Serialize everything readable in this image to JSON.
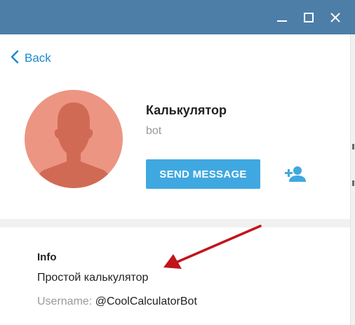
{
  "window": {
    "controls": [
      "minimize-icon",
      "maximize-icon",
      "close-icon"
    ],
    "titlebar_color": "#4d7ea8"
  },
  "nav": {
    "back_label": "Back",
    "back_icon": "chevron-left-icon"
  },
  "profile": {
    "name": "Калькулятор",
    "subtitle": "bot",
    "avatar_icon": "user-silhouette-icon",
    "avatar_color": "#ec9583",
    "send_button_label": "SEND MESSAGE",
    "add_contact_icon": "add-user-icon"
  },
  "info": {
    "title": "Info",
    "description": "Простой калькулятор",
    "username_label": "Username:",
    "username_value": "@CoolCalculatorBot"
  },
  "colors": {
    "accent": "#40a8e0",
    "link": "#168acd",
    "annotation_arrow": "#c0151b"
  }
}
